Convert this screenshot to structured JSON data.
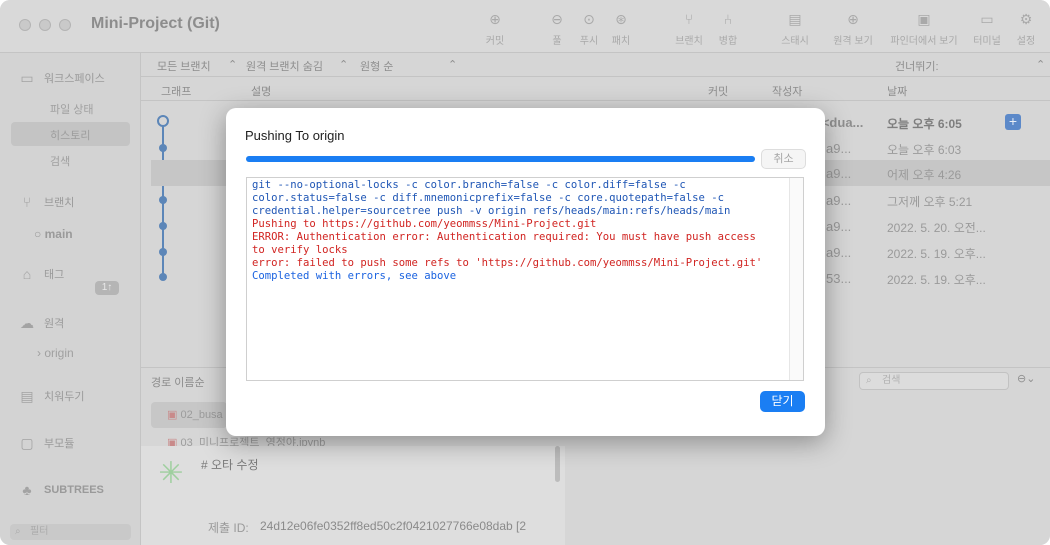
{
  "window": {
    "title": "Mini-Project (Git)"
  },
  "toolbar": {
    "buttons": [
      {
        "label": "커밋",
        "icon": "commit-icon"
      },
      {
        "label": "풀",
        "icon": "pull-icon"
      },
      {
        "label": "푸시",
        "icon": "push-icon"
      },
      {
        "label": "패치",
        "icon": "fetch-icon"
      },
      {
        "label": "브랜치",
        "icon": "branch-icon"
      },
      {
        "label": "병합",
        "icon": "merge-icon"
      },
      {
        "label": "스태시",
        "icon": "stash-icon"
      },
      {
        "label": "원격 보기",
        "icon": "globe-icon"
      },
      {
        "label": "파인더에서 보기",
        "icon": "finder-icon"
      },
      {
        "label": "터미널",
        "icon": "terminal-icon"
      },
      {
        "label": "설정",
        "icon": "gear-icon"
      }
    ]
  },
  "sidebar": {
    "workspace": "워크스페이스",
    "file_status": "파일 상태",
    "history": "히스토리",
    "search": "검색",
    "branches": "브랜치",
    "current_branch": "main",
    "branch_badge": "1↑",
    "tags": "태그",
    "remotes": "원격",
    "remote_origin": "origin",
    "stashes": "치워두기",
    "submodules": "부모듈",
    "subtrees": "SUBTREES",
    "filter_placeholder": "필터"
  },
  "filter_bar": {
    "all_branches": "모든 브랜치",
    "hide_remote": "원격 브랜치 숨김",
    "order": "원형 순",
    "jump_to": "건너뛰기:"
  },
  "columns": {
    "graph": "그래프",
    "description": "설명",
    "commit": "커밋",
    "author": "작성자",
    "date": "날짜"
  },
  "commits": [
    {
      "author": "s <dua...",
      "date": "오늘 오후 6:05"
    },
    {
      "author": "a9...",
      "date": "오늘 오후 6:03"
    },
    {
      "author": "a9...",
      "date": "어제 오후 4:26"
    },
    {
      "author": "a9...",
      "date": "그저께 오후 5:21"
    },
    {
      "author": "a9...",
      "date": "2022. 5. 20. 오전..."
    },
    {
      "author": "a9...",
      "date": "2022. 5. 19. 오후..."
    },
    {
      "author": "53...",
      "date": "2022. 5. 19. 오후..."
    }
  ],
  "lower": {
    "path_sort": "경로 이름순",
    "files": [
      "02_busa",
      "03_미니프로젝트_영정야.ipynb"
    ],
    "commit_message": "# 오타 수정",
    "commit_id_label": "제출 ID:",
    "commit_id_value": "24d12e06fe0352ff8ed50c2f0421027766e08dab [2",
    "search_placeholder": "검색"
  },
  "dialog": {
    "title": "Pushing To origin",
    "progress": 1.0,
    "cancel_label": "취소",
    "close_label": "닫기",
    "log": [
      {
        "kind": "cmd",
        "text": "git --no-optional-locks -c color.branch=false -c color.diff=false -c"
      },
      {
        "kind": "cmd",
        "text": "color.status=false -c diff.mnemonicprefix=false -c core.quotepath=false -c"
      },
      {
        "kind": "cmd",
        "text": "credential.helper=sourcetree push -v origin refs/heads/main:refs/heads/main"
      },
      {
        "kind": "err",
        "text": "Pushing to https://github.com/yeommss/Mini-Project.git"
      },
      {
        "kind": "err",
        "text": "ERROR: Authentication error: Authentication required: You must have push access"
      },
      {
        "kind": "err",
        "text": "to verify locks"
      },
      {
        "kind": "err",
        "text": "error: failed to push some refs to 'https://github.com/yeommss/Mini-Project.git'"
      },
      {
        "kind": "done",
        "text": "Completed with errors, see above"
      }
    ]
  },
  "colors": {
    "accent": "#1a7ef3",
    "error_text": "#d12421",
    "command_text": "#1f56b5",
    "graph_line": "#5c86b8"
  }
}
